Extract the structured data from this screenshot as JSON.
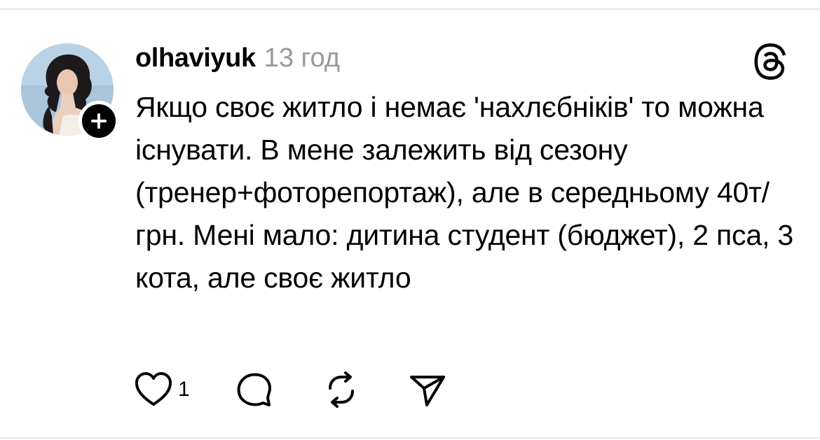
{
  "post": {
    "username": "olhaviyuk",
    "time_ago": "13 год",
    "text": "Якщо своє житло і немає 'нахлєбніків' то можна існувати. В мене залежить від сезону (тренер+фоторепортаж), але в середньому 40т/грн. Мені мало: дитина студент (бюджет), 2 пса, 3 кота, але своє житло",
    "like_count": "1"
  },
  "icons": {
    "follow": "plus-icon",
    "brand": "threads-logo",
    "like": "heart-icon",
    "reply": "comment-icon",
    "repost": "repost-icon",
    "share": "send-icon"
  },
  "colors": {
    "text": "#000000",
    "muted": "#999999",
    "divider": "#e6e6e6",
    "badge": "#000000"
  }
}
